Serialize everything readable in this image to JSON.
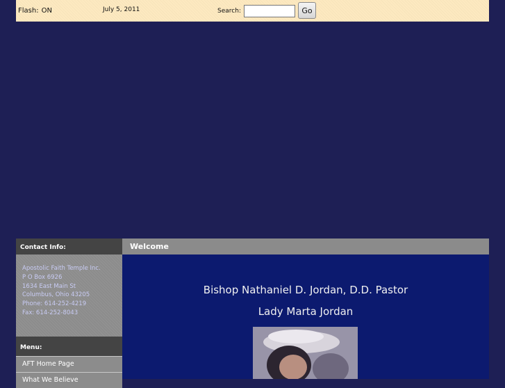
{
  "topbar": {
    "flash_label": "Flash:",
    "flash_value": "ON",
    "date": "July 5, 2011",
    "search_label": "Search:",
    "search_value": "",
    "go_label": "Go"
  },
  "sidebar": {
    "contact_heading": "Contact Info:",
    "contact_lines": [
      "Apostolic Faith Temple Inc.",
      "P O Box 6926",
      "1634 East Main St",
      "Columbus, Ohio 43205",
      "Phone: 614-252-4219",
      "Fax: 614-252-8043"
    ],
    "menu_heading": "Menu:",
    "menu_items": [
      {
        "label": "AFT Home Page"
      },
      {
        "label": "What We Believe"
      }
    ]
  },
  "main": {
    "heading": "Welcome",
    "pastor_line": "Bishop Nathaniel D. Jordan, D.D. Pastor",
    "lady_line": "Lady Marta Jordan"
  },
  "colors": {
    "page_bg": "#1e1f55",
    "topbar_bg": "#fde9c0",
    "header_bg": "#444444",
    "sidebar_bg": "#8c8c8c",
    "content_bg": "#0c1a6f",
    "contact_text": "#c9ccf5"
  }
}
